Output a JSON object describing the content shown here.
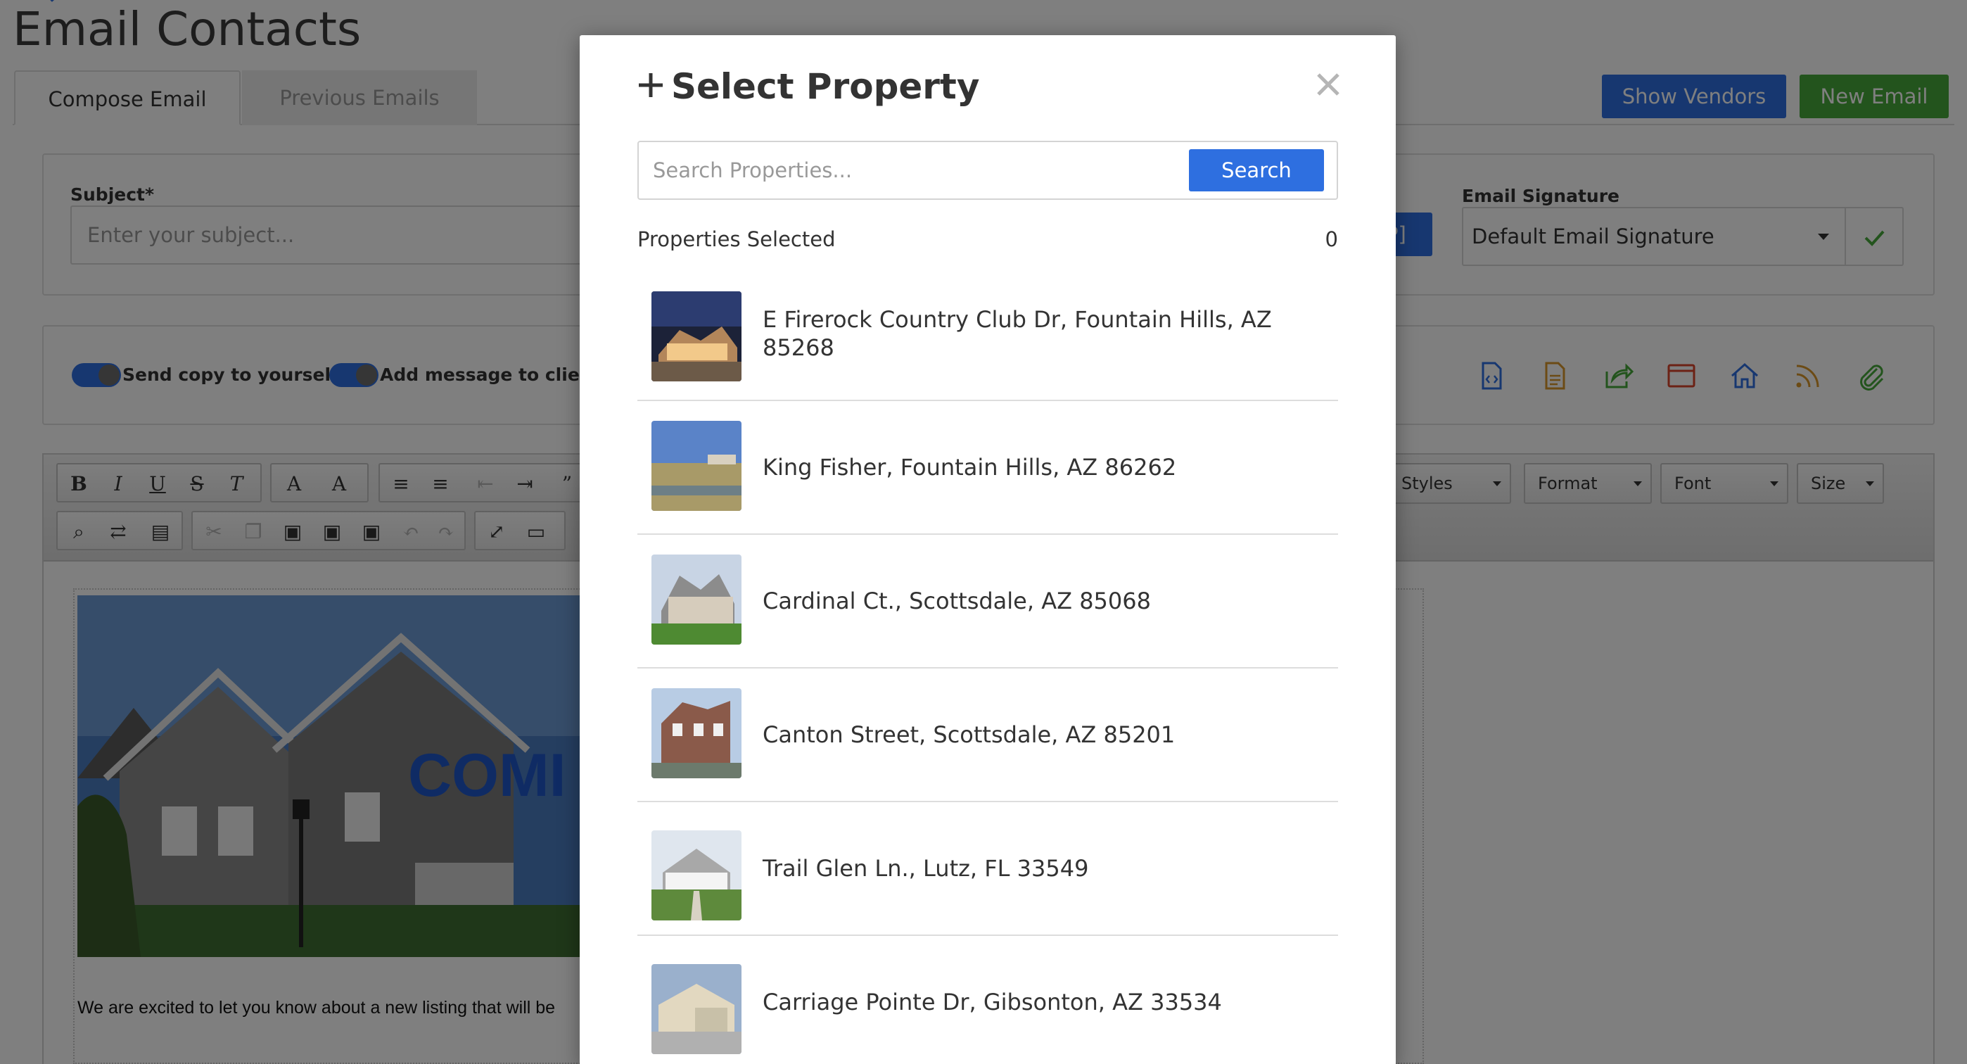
{
  "page": {
    "title": "Email Contacts",
    "tabs": [
      {
        "label": "Compose Email",
        "active": true
      },
      {
        "label": "Previous Emails",
        "active": false
      }
    ],
    "buttons": {
      "show_vendors": "Show Vendors",
      "new_email": "New Email"
    },
    "subject": {
      "label": "Subject*",
      "placeholder": "Enter your subject..."
    },
    "insert_button_glyph": "P]",
    "signature": {
      "label": "Email Signature",
      "selected": "Default Email Signature"
    },
    "toggles": [
      {
        "label": "Send copy to yourself",
        "on": true
      },
      {
        "label": "Add message to client",
        "on": true
      }
    ],
    "tool_icons": [
      "html-file-icon",
      "document-icon",
      "share-icon",
      "browser-window-icon",
      "home-icon",
      "rss-icon",
      "paperclip-icon"
    ],
    "editor": {
      "combos": [
        "Styles",
        "Format",
        "Font",
        "Size"
      ],
      "banner_text": "COMI",
      "body_line_1": "We are excited to let you know about a new listing that will be"
    }
  },
  "modal": {
    "title": "Select Property",
    "search": {
      "placeholder": "Search Properties...",
      "button": "Search"
    },
    "selected_label": "Properties Selected",
    "selected_count": "0",
    "properties": [
      {
        "address": "E Firerock Country Club Dr, Fountain Hills, AZ 85268"
      },
      {
        "address": "King Fisher, Fountain Hills, AZ 86262"
      },
      {
        "address": "Cardinal Ct., Scottsdale, AZ 85068"
      },
      {
        "address": "Canton Street, Scottsdale, AZ 85201"
      },
      {
        "address": "Trail Glen Ln., Lutz, FL 33549"
      },
      {
        "address": "Carriage Pointe Dr, Gibsonton, AZ 33534"
      }
    ]
  },
  "colors": {
    "primary_blue": "#2e6fe0",
    "success_green": "#46a83a",
    "overlay": "rgba(0,0,0,0.5)"
  }
}
